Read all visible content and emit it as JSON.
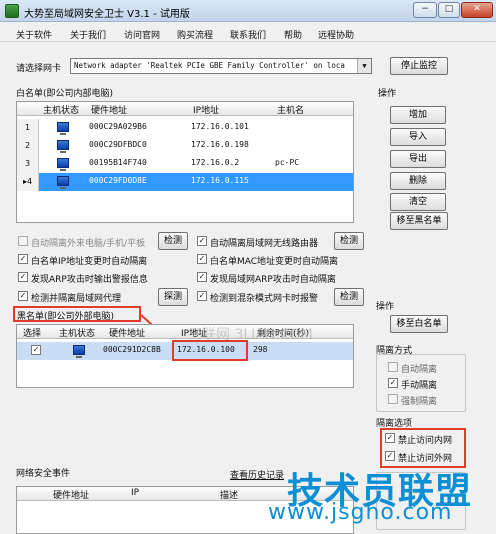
{
  "window": {
    "title": "大势至局域网安全卫士 V3.1 - 试用版",
    "minimize": "−",
    "restore": "□",
    "close": "✕"
  },
  "menu": [
    "关于软件",
    "关于我们",
    "访问官网",
    "购买流程",
    "联系我们",
    "帮助",
    "远程协助"
  ],
  "adapter": {
    "label": "请选择网卡",
    "value": "Network adapter 'Realtek PCIe GBE Family Controller' on loca",
    "stop_button": "停止监控"
  },
  "whitelist": {
    "title": "白名单(即公司内部电脑)",
    "headers": [
      "主机状态",
      "硬件地址",
      "IP地址",
      "主机名"
    ],
    "rows": [
      {
        "num": "1",
        "mac": "000C29A029B6",
        "ip": "172.16.0.101",
        "host": ""
      },
      {
        "num": "2",
        "mac": "000C29DFBDC0",
        "ip": "172.16.0.198",
        "host": ""
      },
      {
        "num": "3",
        "mac": "00195B14F740",
        "ip": "172.16.0.2",
        "host": "pc-PC"
      },
      {
        "num": "▸4",
        "mac": "000C29FD0D8E",
        "ip": "172.16.0.115",
        "host": ""
      }
    ]
  },
  "ops1": {
    "title": "操作",
    "buttons": [
      "增加",
      "导入",
      "导出",
      "删除",
      "清空",
      "移至黑名单"
    ]
  },
  "options": {
    "o1": "自动隔离外来电脑/手机/平板",
    "o2": "自动隔离局域网无线路由器",
    "o3": "白名单IP地址变更时自动隔离",
    "o4": "白名单MAC地址变更时自动隔离",
    "o5": "发现ARP攻击时输出警报信息",
    "o6": "发现局域网ARP攻击时自动隔离",
    "o7": "检测并隔离局域网代理",
    "o8": "检测到混杂模式网卡时报警",
    "detect": "检测",
    "probe": "探测"
  },
  "blacklist": {
    "title": "黑名单(即公司外部电脑)",
    "headers": [
      "选择",
      "主机状态",
      "硬件地址",
      "IP地址",
      "剩余时间(秒)"
    ],
    "rows": [
      {
        "checked": "✓",
        "mac": "000C291D2C8B",
        "ip": "172.16.0.100",
        "remaining": "298"
      }
    ]
  },
  "ops2": {
    "title": "操作",
    "button": "移至白名单"
  },
  "isolation": {
    "title": "隔离方式",
    "auto": "自动隔离",
    "manual": "手动隔离",
    "force": "强制隔离",
    "auto_checked": "",
    "manual_checked": "✓",
    "force_checked": ""
  },
  "iso_opts": {
    "title": "隔离选项",
    "intranet": "禁止访问内网",
    "internet": "禁止访问外网",
    "intranet_checked": "✓",
    "internet_checked": "✓"
  },
  "events": {
    "title": "网络安全事件",
    "history": "查看历史记录",
    "headers": [
      "硬件地址",
      "IP",
      "描述"
    ]
  },
  "watermarks": {
    "main": "技术员联盟",
    "url": "www.jsgho.com",
    "faint": "三联网 3LIAN.COM"
  },
  "colors": {
    "selection": "#3399ff",
    "accent_red": "#e23b2b",
    "watermark_blue": "#0d8fd6"
  }
}
